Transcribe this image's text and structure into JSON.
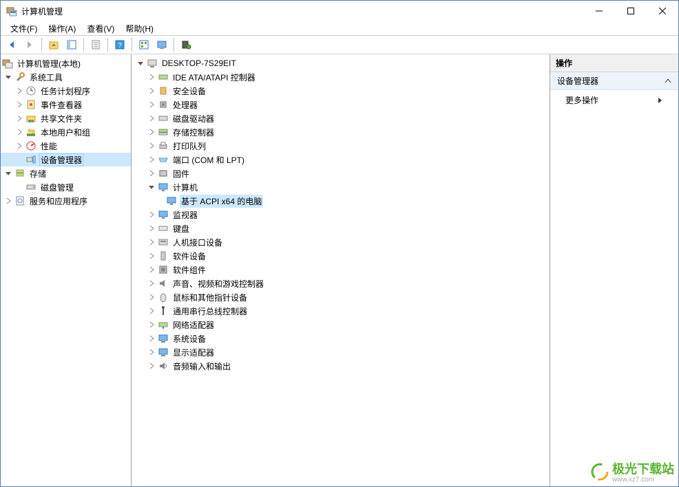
{
  "window": {
    "title": "计算机管理"
  },
  "menus": {
    "file": "文件(F)",
    "action": "操作(A)",
    "view": "查看(V)",
    "help": "帮助(H)"
  },
  "left_tree": {
    "root": "计算机管理(本地)",
    "system_tools": "系统工具",
    "task_scheduler": "任务计划程序",
    "event_viewer": "事件查看器",
    "shared_folders": "共享文件夹",
    "local_users": "本地用户和组",
    "performance": "性能",
    "device_manager": "设备管理器",
    "storage": "存储",
    "disk_mgmt": "磁盘管理",
    "services_apps": "服务和应用程序"
  },
  "device_tree": {
    "root": "DESKTOP-7S29EIT",
    "ide": "IDE ATA/ATAPI 控制器",
    "security": "安全设备",
    "processors": "处理器",
    "disk_drives": "磁盘驱动器",
    "storage_ctrl": "存储控制器",
    "print_queues": "打印队列",
    "ports": "端口 (COM 和 LPT)",
    "firmware": "固件",
    "computer": "计算机",
    "computer_child": "基于 ACPI x64 的电脑",
    "monitors": "监视器",
    "keyboards": "键盘",
    "hid": "人机接口设备",
    "software_dev": "软件设备",
    "software_comp": "软件组件",
    "sound": "声音、视频和游戏控制器",
    "mouse": "鼠标和其他指针设备",
    "usb": "通用串行总线控制器",
    "network": "网络适配器",
    "system_dev": "系统设备",
    "display": "显示适配器",
    "audio_io": "音频输入和输出"
  },
  "actions": {
    "header": "操作",
    "section": "设备管理器",
    "more": "更多操作"
  },
  "watermark": {
    "name": "极光下载站",
    "url": "www.xz7.com"
  }
}
